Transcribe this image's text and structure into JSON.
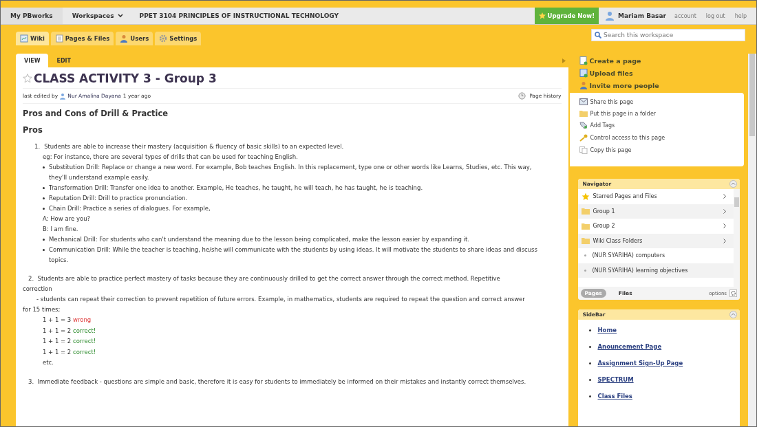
{
  "topbar": {
    "brand": "My PBworks",
    "workspaces": "Workspaces",
    "workspace_title": "PPET 3104 PRINCIPLES OF INSTRUCTIONAL TECHNOLOGY",
    "upgrade": "Upgrade Now!",
    "user": "Mariam Basar",
    "links": [
      "account",
      "log out",
      "help"
    ]
  },
  "nav_tabs": [
    {
      "label": "Wiki",
      "kind": "wiki",
      "selected": true
    },
    {
      "label": "Pages & Files",
      "kind": "pages",
      "selected": false
    },
    {
      "label": "Users",
      "kind": "users",
      "selected": false
    },
    {
      "label": "Settings",
      "kind": "settings",
      "selected": false
    }
  ],
  "search": {
    "placeholder": "Search this workspace"
  },
  "page_tabs": [
    {
      "label": "VIEW",
      "selected": true
    },
    {
      "label": "EDIT",
      "selected": false
    }
  ],
  "page": {
    "title": "CLASS ACTIVITY 3 - Group 3",
    "starred": false,
    "edited_prefix": "last edited by",
    "editor": "Nur Amalina Dayana",
    "edited_when": "1 year ago",
    "history": "Page history"
  },
  "body": [
    {
      "kind": "h2",
      "text": "Pros and Cons of Drill & Practice"
    },
    {
      "kind": "h2",
      "text": "Pros"
    },
    {
      "kind": "numbered",
      "number": "1.",
      "text": "Students are able to increase their mastery (acquisition & fluency of basic skills) to an expected level."
    },
    {
      "kind": "indent",
      "text": "eg: For instance, there are several types of drills that can be used for teaching English."
    },
    {
      "kind": "bullet",
      "text": "Substitution Drill: Replace or change a new word. For example, Bob teaches English. In this replacement, type one or other words like Learns, Studies, etc. This way, they'll understand example easily."
    },
    {
      "kind": "bullet",
      "text": "Transformation Drill: Transfer one idea to another. Example, He teaches, he taught, he will teach, he has taught, he is teaching."
    },
    {
      "kind": "bullet",
      "text": " Reputation Drill: Drill to practice pronunciation."
    },
    {
      "kind": "bullet",
      "text": "Chain Drill: Practice a series of dialogues. For example,"
    },
    {
      "kind": "indent",
      "text": "A: How are you?"
    },
    {
      "kind": "indent",
      "text": "B: I am fine."
    },
    {
      "kind": "bullet",
      "text": "Mechanical Drill: For students who can't understand the meaning due to the lesson being complicated, make the lesson easier by expanding it."
    },
    {
      "kind": "bullet",
      "text": "Communication Drill: While the teacher is teaching, he/she will communicate with the students by using ideas. It will motivate the students to share ideas and discuss topics."
    },
    {
      "kind": "para",
      "number": "2.",
      "text": "Students are able to practice perfect mastery of tasks because they are continuously drilled to get the correct answer through the correct method. Repetitive correction"
    },
    {
      "kind": "para",
      "text": "- students can repeat their correction to prevent repetition of future errors. Example, in mathematics, students are required to repeat the question and correct answer for           15 times;"
    },
    {
      "kind": "equation",
      "expr": "1 + 1 = 3",
      "verdict": "wrong",
      "correct": false
    },
    {
      "kind": "equation",
      "expr": "1 + 1 = 2",
      "verdict": "correct!",
      "correct": true
    },
    {
      "kind": "equation",
      "expr": "1 + 1 = 2",
      "verdict": "correct!",
      "correct": true
    },
    {
      "kind": "equation",
      "expr": "1 + 1 = 2",
      "verdict": "correct!",
      "correct": true
    },
    {
      "kind": "equation",
      "expr": "etc."
    },
    {
      "kind": "para",
      "number": "3.",
      "text": "Immediate feedback - questions are simple and basic, therefore it is easy for students to immediately be informed on their mistakes and instantly correct themselves."
    }
  ],
  "actions": [
    {
      "label": "Create a page",
      "kind": "page"
    },
    {
      "label": "Upload files",
      "kind": "upload"
    },
    {
      "label": "Invite more people",
      "kind": "people"
    }
  ],
  "page_actions": [
    {
      "label": "Share this page",
      "kind": "share"
    },
    {
      "label": "Put this page in a folder",
      "kind": "folder"
    },
    {
      "label": "Add Tags",
      "kind": "tag"
    },
    {
      "label": "Control access to this page",
      "kind": "key"
    },
    {
      "label": "Copy this page",
      "kind": "copy"
    }
  ],
  "navigator": {
    "title": "Navigator",
    "items": [
      {
        "label": "Starred Pages and Files",
        "kind": "star"
      },
      {
        "label": "Group 1",
        "kind": "folder"
      },
      {
        "label": "Group 2",
        "kind": "folder"
      },
      {
        "label": "Wiki Class Folders",
        "kind": "folder"
      },
      {
        "label": "(NUR SYARIHA) computers",
        "kind": "page"
      },
      {
        "label": "(NUR SYARIHA) learning objectives",
        "kind": "page"
      }
    ],
    "tabs": [
      {
        "label": "Pages",
        "selected": true
      },
      {
        "label": "Files",
        "selected": false
      }
    ],
    "options": "options"
  },
  "sidebar": {
    "title": "SideBar",
    "links": [
      "Home",
      "Anouncement Page",
      "Assignment Sign-Up Page",
      "SPECTRUM",
      "Class Files"
    ]
  }
}
